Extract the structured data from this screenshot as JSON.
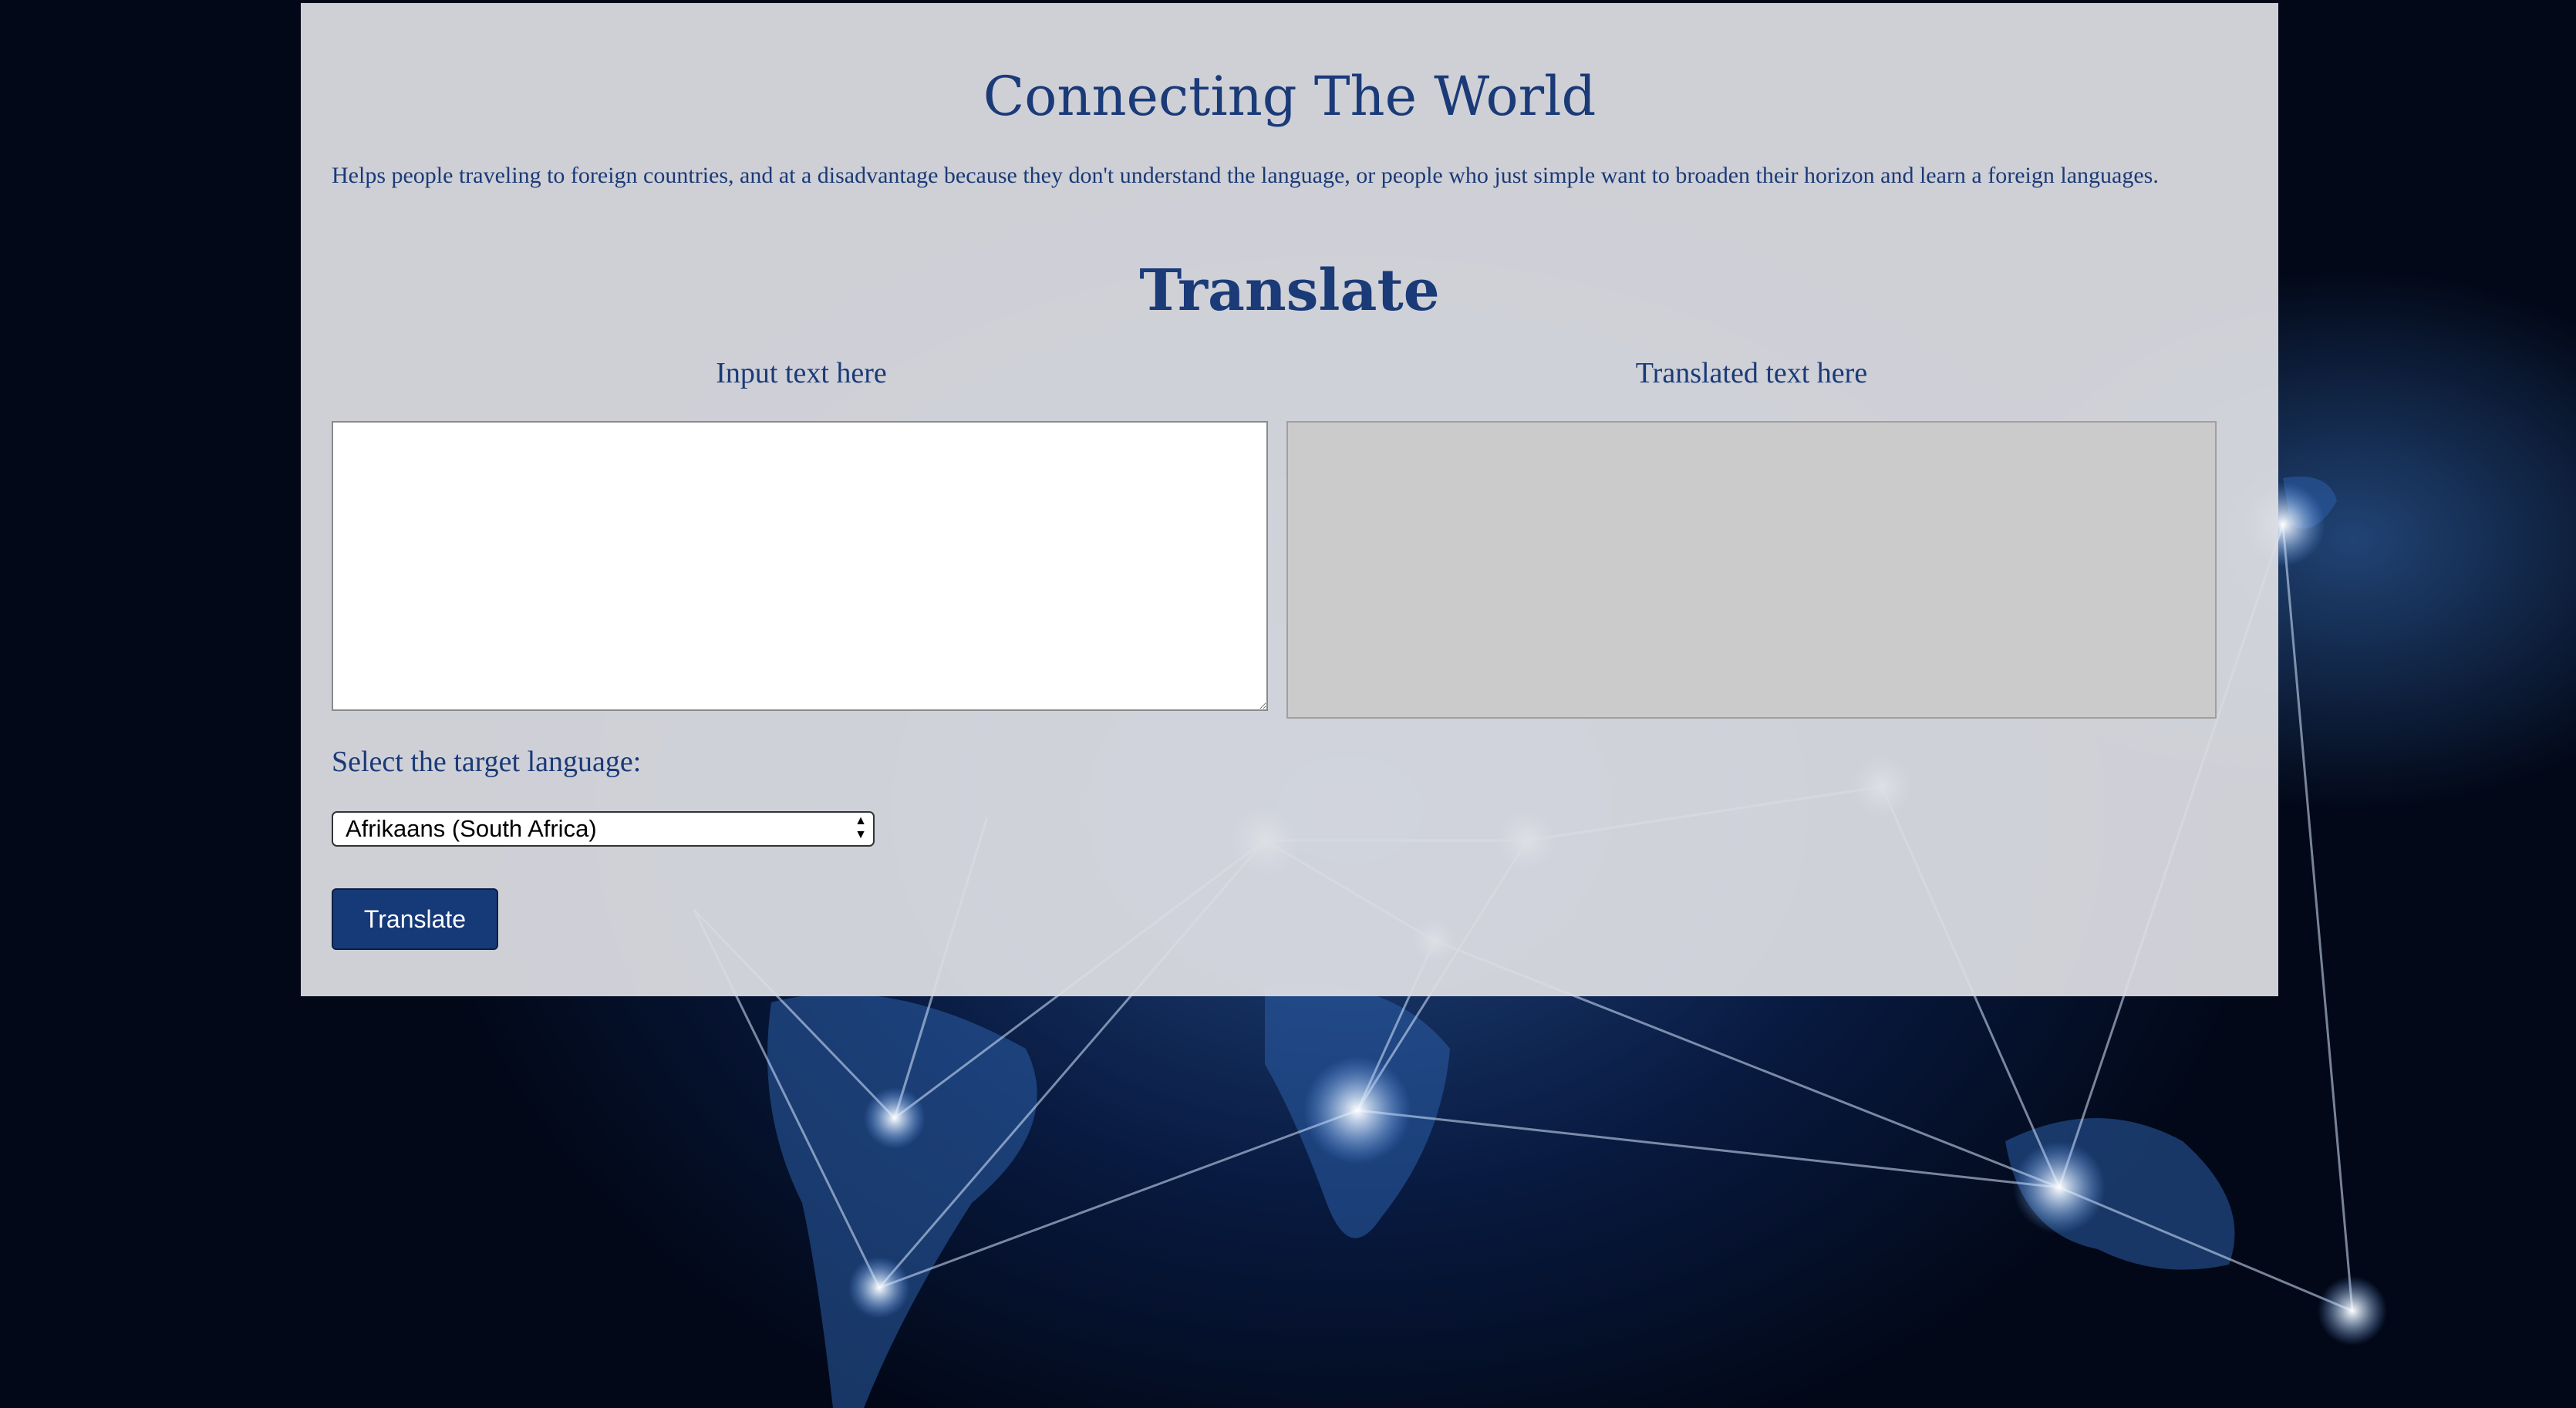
{
  "header": {
    "title": "Connecting The World",
    "description": "Helps people traveling to foreign countries, and at a disadvantage because they don't understand the language, or people who just simple want to broaden their horizon and learn a foreign languages."
  },
  "translator": {
    "heading": "Translate",
    "input_label": "Input text here",
    "input_value": "",
    "output_label": "Translated text here",
    "output_value": "",
    "select_label": "Select the target language:",
    "selected_language": "Afrikaans (South Africa)",
    "button_label": "Translate"
  },
  "colors": {
    "text": "#1a3a78",
    "button": "#163a78",
    "panel": "#dcdde2",
    "output_box": "#cbcbcb"
  }
}
